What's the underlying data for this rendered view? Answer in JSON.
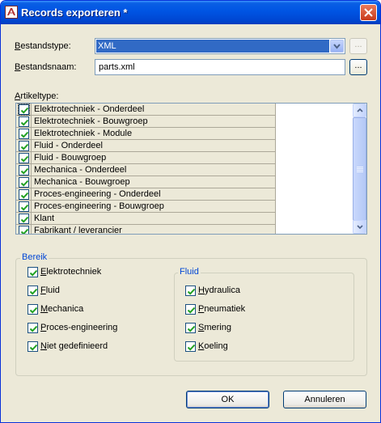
{
  "window": {
    "title": "Records exporteren *"
  },
  "file_type": {
    "label": "Bestandstype:",
    "accel": "B",
    "rest": "estandstype:",
    "value": "XML"
  },
  "file_name": {
    "label": "Bestandsnaam:",
    "accel": "B",
    "rest": "estandsnaam:",
    "value": "parts.xml"
  },
  "browse_disabled_label": "...",
  "browse_label": "...",
  "article_type": {
    "label": "Artikeltype:",
    "accel": "A",
    "rest": "rtikeltype:",
    "items": [
      "Elektrotechniek - Onderdeel",
      "Elektrotechniek - Bouwgroep",
      "Elektrotechniek - Module",
      "Fluid - Onderdeel",
      "Fluid - Bouwgroep",
      "Mechanica - Onderdeel",
      "Mechanica - Bouwgroep",
      "Proces-engineering - Onderdeel",
      "Proces-engineering - Bouwgroep",
      "Klant",
      "Fabrikant / leverancier"
    ]
  },
  "range": {
    "title": "Bereik",
    "items": [
      {
        "accel": "E",
        "rest": "lektrotechniek",
        "checked": true
      },
      {
        "accel": "F",
        "rest": "luid",
        "checked": true
      },
      {
        "accel": "M",
        "rest": "echanica",
        "checked": true
      },
      {
        "accel": "P",
        "rest": "roces-engineering",
        "checked": true
      },
      {
        "accel": "N",
        "rest": "iet gedefinieerd",
        "checked": true
      }
    ]
  },
  "fluid": {
    "title": "Fluid",
    "items": [
      {
        "accel": "H",
        "rest": "ydraulica",
        "checked": true
      },
      {
        "accel": "P",
        "rest": "neumatiek",
        "checked": true
      },
      {
        "accel": "S",
        "rest": "mering",
        "checked": true
      },
      {
        "accel": "K",
        "rest": "oeling",
        "checked": true
      }
    ]
  },
  "buttons": {
    "ok": "OK",
    "cancel": "Annuleren"
  },
  "colors": {
    "title_bar": "#0054e3",
    "dialog_bg": "#ece9d8",
    "selection": "#316ac5",
    "group_title": "#0046d5",
    "checkmark": "#21a121"
  }
}
